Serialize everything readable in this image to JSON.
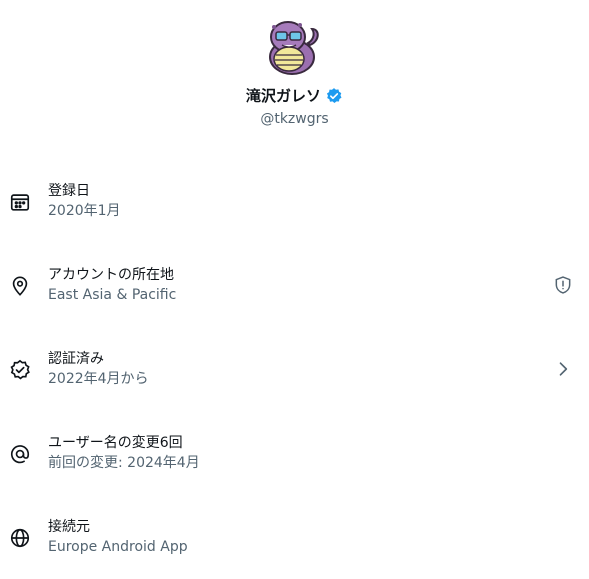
{
  "profile": {
    "display_name": "滝沢ガレソ",
    "handle": "@tkzwgrs",
    "avatar_icon": "purple-character-avatar",
    "verified_icon": "verified-badge-icon",
    "verified_color": "#1d9bf0"
  },
  "about": {
    "rows": [
      {
        "icon": "calendar-icon",
        "title": "登録日",
        "sub": "2020年1月",
        "right_icon": ""
      },
      {
        "icon": "location-pin-icon",
        "title": "アカウントの所在地",
        "sub": "East Asia & Pacific",
        "right_icon": "shield-info-icon"
      },
      {
        "icon": "verified-check-icon",
        "title": "認証済み",
        "sub": "2022年4月から",
        "right_icon": "chevron-right-icon"
      },
      {
        "icon": "at-sign-icon",
        "title": "ユーザー名の変更6回",
        "sub": "前回の変更: 2024年4月",
        "right_icon": ""
      },
      {
        "icon": "globe-icon",
        "title": "接続元",
        "sub": "Europe Android App",
        "right_icon": ""
      }
    ]
  },
  "colors": {
    "text_primary": "#0f1419",
    "text_secondary": "#536471"
  }
}
